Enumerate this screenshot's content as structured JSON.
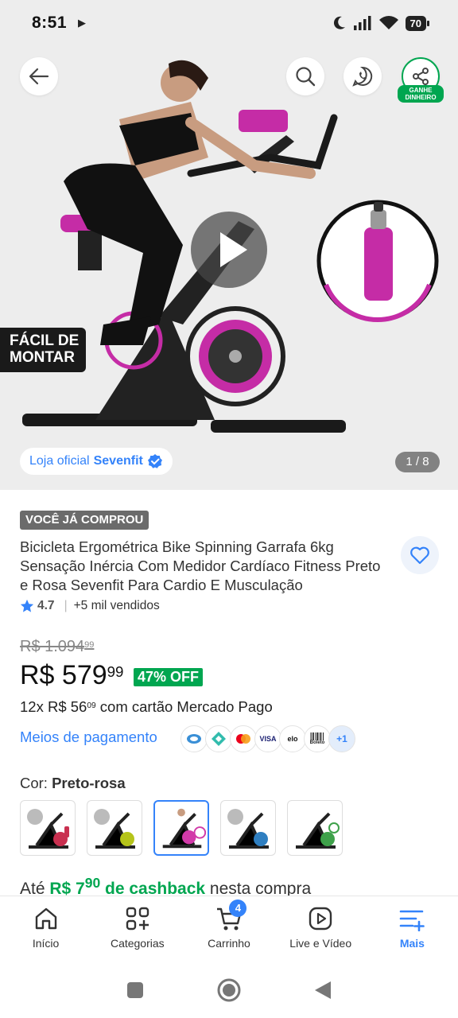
{
  "status_bar": {
    "time": "8:51",
    "battery": "70"
  },
  "header_actions": {
    "share_badge": "GANHE DINHEIRO"
  },
  "gallery": {
    "overlay_label": "FÁCIL DE MONTAR",
    "store_prefix": "Loja oficial",
    "store_name": "Sevenfit",
    "counter": "1 / 8"
  },
  "product": {
    "purchased_badge": "VOCÊ JÁ COMPROU",
    "title": "Bicicleta Ergométrica Bike Spinning Garrafa 6kg Sensação Inércia Com Medidor Cardíaco Fitness Preto e Rosa Sevenfit Para Cardio E Musculação",
    "rating": "4.7",
    "sold": "+5 mil vendidos",
    "old_price_main": "R$ 1.094",
    "old_price_cents": "99",
    "price_main": "R$ 579",
    "price_cents": "99",
    "discount": "47% OFF",
    "installment_prefix": "12x R$ 56",
    "installment_cents": "09",
    "installment_suffix": " com cartão Mercado Pago",
    "payment_link": "Meios de pagamento",
    "payment_methods": [
      "",
      "",
      "",
      "VISA",
      "elo",
      "Boleto"
    ],
    "payment_more": "+1"
  },
  "variant": {
    "label": "Cor:",
    "value": "Preto-rosa",
    "options": [
      {
        "color": "#c93050"
      },
      {
        "color": "#b5c41a"
      },
      {
        "color": "#d23aa9"
      },
      {
        "color": "#2f7fc1"
      },
      {
        "color": "#3ea14a"
      }
    ],
    "selected_index": 2
  },
  "cashback": {
    "prefix": "Até ",
    "amount_main": "R$ 7",
    "amount_cents": "90",
    "mid": " de cashback",
    "suffix": " nesta compra"
  },
  "bottom_nav": {
    "items": [
      {
        "label": "Início"
      },
      {
        "label": "Categorias"
      },
      {
        "label": "Carrinho"
      },
      {
        "label": "Live e Vídeo"
      },
      {
        "label": "Mais"
      }
    ],
    "cart_count": "4"
  },
  "colors": {
    "accent": "#3483fa",
    "green": "#00a650",
    "brand_pink": "#c52ca6"
  }
}
